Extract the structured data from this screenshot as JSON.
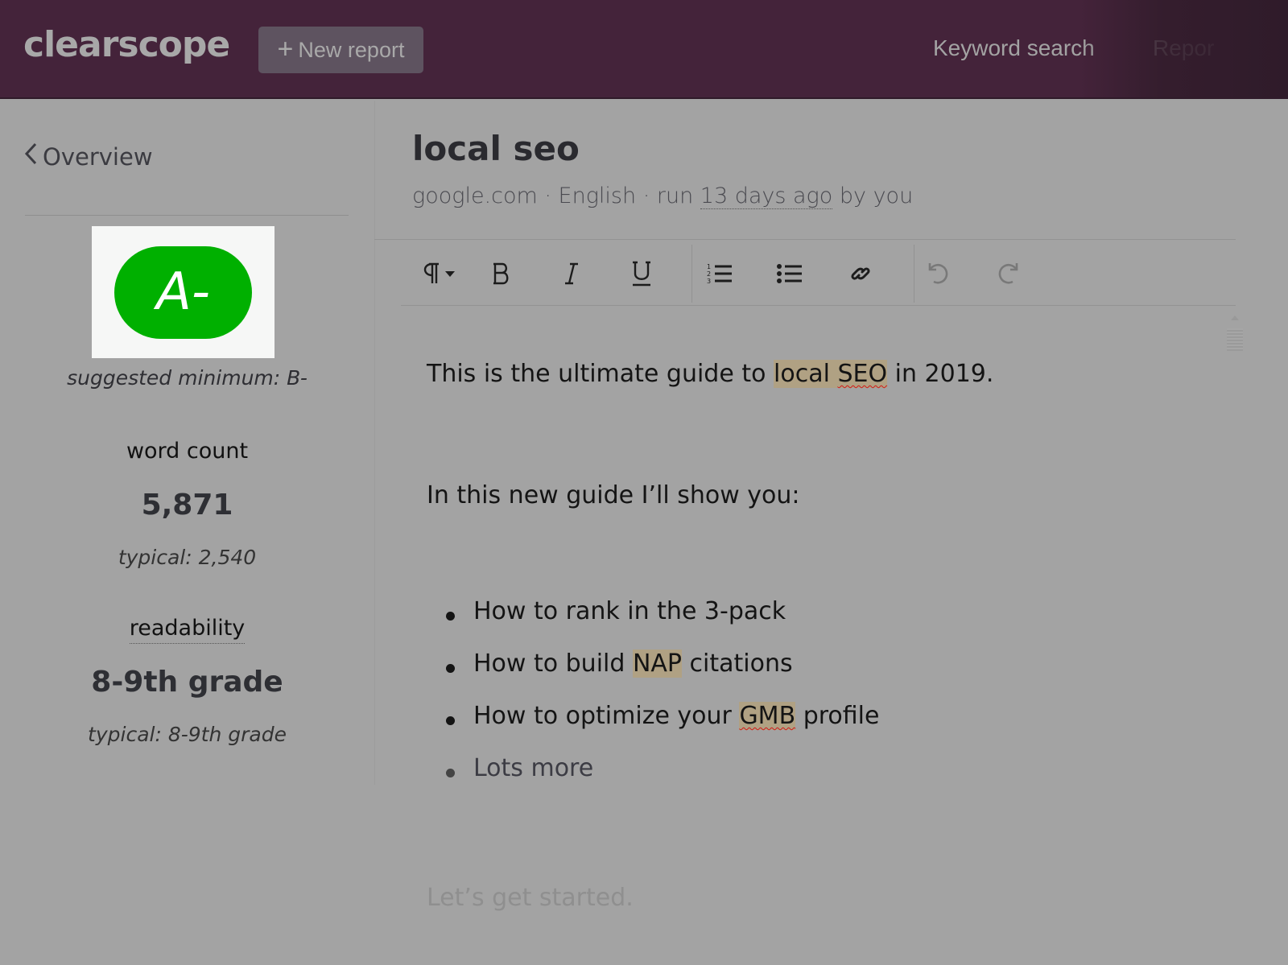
{
  "header": {
    "logo": "clearscope",
    "new_report_icon": "plus-icon",
    "new_report_label": "New report",
    "nav": [
      {
        "label": "Keyword search"
      },
      {
        "label": "Repor"
      }
    ]
  },
  "sidebar": {
    "back_icon": "chevron-left-icon",
    "back_label": "Overview",
    "grade": "A-",
    "grade_color": "#00b000",
    "suggested_minimum": "suggested minimum: B-",
    "word_count": {
      "label": "word count",
      "value": "5,871",
      "typical": "typical: 2,540"
    },
    "readability": {
      "label": "readability",
      "value": "8-9th grade",
      "typical": "typical: 8-9th grade"
    }
  },
  "document": {
    "title": "local seo",
    "meta_prefix": "google.com · English · run ",
    "meta_when": "13 days ago",
    "meta_suffix": " by you"
  },
  "toolbar": {
    "buttons": [
      {
        "name": "paragraph-format",
        "icon": "pilcrow-icon"
      },
      {
        "name": "bold",
        "icon": "bold-icon"
      },
      {
        "name": "italic",
        "icon": "italic-icon"
      },
      {
        "name": "underline",
        "icon": "underline-icon"
      },
      {
        "name": "ordered-list",
        "icon": "ordered-list-icon"
      },
      {
        "name": "bullet-list",
        "icon": "bullet-list-icon"
      },
      {
        "name": "link",
        "icon": "link-icon"
      },
      {
        "name": "undo",
        "icon": "undo-icon"
      },
      {
        "name": "redo",
        "icon": "redo-icon"
      }
    ]
  },
  "editor": {
    "highlight_color": "#b0a183",
    "p1": {
      "before": "This is the ultimate guide to ",
      "hl1": "local ",
      "hl2": "SEO",
      "after": " in 2019."
    },
    "p2": "In this new guide I’ll show you:",
    "bullets": [
      {
        "before": "How to rank in the 3-pack",
        "hl": "",
        "after": ""
      },
      {
        "before": "How to build ",
        "hl": "NAP",
        "after": " citations"
      },
      {
        "before": "How to optimize your ",
        "hl": "GMB",
        "after": " profile"
      },
      {
        "before": "Lots more",
        "hl": "",
        "after": ""
      }
    ],
    "p3": "Let’s get started."
  }
}
